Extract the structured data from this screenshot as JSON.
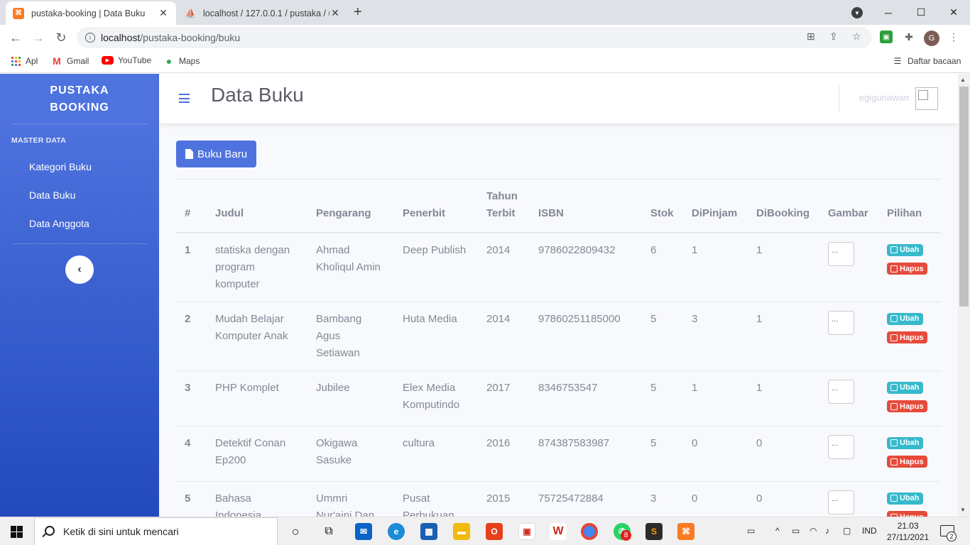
{
  "browser": {
    "tabs": [
      {
        "title": "pustaka-booking | Data Buku",
        "active": true
      },
      {
        "title": "localhost / 127.0.0.1 / pustaka / u",
        "active": false
      }
    ],
    "url_host": "localhost",
    "url_path": "/pustaka-booking/buku",
    "bookmarks": [
      "Apl",
      "Gmail",
      "YouTube",
      "Maps"
    ],
    "reading_list": "Daftar bacaan",
    "profile_initial": "G"
  },
  "sidebar": {
    "brand_line1": "PUSTAKA",
    "brand_line2": "BOOKING",
    "heading": "MASTER DATA",
    "items": [
      {
        "label": "Kategori Buku"
      },
      {
        "label": "Data Buku"
      },
      {
        "label": "Data Anggota"
      }
    ]
  },
  "topbar": {
    "title": "Data Buku",
    "username": "egigunawan"
  },
  "main": {
    "new_button": "Buku Baru",
    "columns": [
      "#",
      "Judul",
      "Pengarang",
      "Penerbit",
      "Tahun Terbit",
      "ISBN",
      "Stok",
      "DiPinjam",
      "DiBooking",
      "Gambar",
      "Pilihan"
    ],
    "rows": [
      {
        "no": "1",
        "judul": "statiska dengan program komputer",
        "pengarang": "Ahmad Kholiqul Amin",
        "penerbit": "Deep Publish",
        "tahun": "2014",
        "isbn": "9786022809432",
        "stok": "6",
        "dipinjam": "1",
        "dibooking": "1",
        "gambar": "..."
      },
      {
        "no": "2",
        "judul": "Mudah Belajar Komputer Anak",
        "pengarang": "Bambang Agus Setiawan",
        "penerbit": "Huta Media",
        "tahun": "2014",
        "isbn": "97860251185000",
        "stok": "5",
        "dipinjam": "3",
        "dibooking": "1",
        "gambar": "..."
      },
      {
        "no": "3",
        "judul": "PHP Komplet",
        "pengarang": "Jubilee",
        "penerbit": "Elex Media Komputindo",
        "tahun": "2017",
        "isbn": "8346753547",
        "stok": "5",
        "dipinjam": "1",
        "dibooking": "1",
        "gambar": "..."
      },
      {
        "no": "4",
        "judul": "Detektif Conan Ep200",
        "pengarang": "Okigawa Sasuke",
        "penerbit": "cultura",
        "tahun": "2016",
        "isbn": "874387583987",
        "stok": "5",
        "dipinjam": "0",
        "dibooking": "0",
        "gambar": "..."
      },
      {
        "no": "5",
        "judul": "Bahasa Indonesia",
        "pengarang": "Ummri Nur'aini Dan",
        "penerbit": "Pusat Perbukuan",
        "tahun": "2015",
        "isbn": "75725472884",
        "stok": "3",
        "dipinjam": "0",
        "dibooking": "0",
        "gambar": "..."
      }
    ],
    "edit_label": "Ubah",
    "delete_label": "Hapus"
  },
  "taskbar": {
    "search_placeholder": "Ketik di sini untuk mencari",
    "language": "IND",
    "time": "21.03",
    "date": "27/11/2021",
    "whatsapp_badge": "8",
    "notification_count": "2"
  },
  "colors": {
    "primary": "#4e73df",
    "info": "#36b9cc",
    "danger": "#e74a3b"
  }
}
